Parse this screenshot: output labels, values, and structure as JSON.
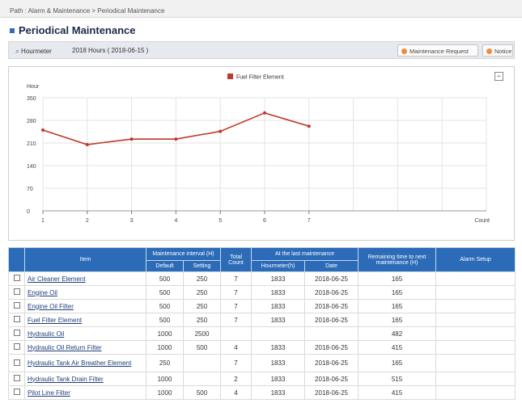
{
  "breadcrumb": "Path : Alarm & Maintenance > Periodical Maintenance",
  "page_title": "Periodical Maintenance",
  "infobar": {
    "hourmeter_label": "Hourmeter",
    "hourmeter_value": "2018 Hours ( 2018-06-15 )",
    "maintenance_request_label": "Maintenance Request",
    "notice_label": "Notice"
  },
  "chart_data": {
    "type": "line",
    "title": "",
    "ylabel": "Hour",
    "xlabel": "Count",
    "ylim": [
      0,
      350
    ],
    "yticks": [
      0,
      70,
      140,
      210,
      280,
      350
    ],
    "xticks": [
      "1",
      "2",
      "3",
      "4",
      "5",
      "6",
      "7"
    ],
    "x_slots": 11,
    "series": [
      {
        "name": "Fuel Filter Element",
        "color": "#c0392b",
        "x": [
          1,
          2,
          3,
          4,
          5,
          6,
          7
        ],
        "values": [
          250,
          205,
          222,
          222,
          246,
          303,
          262
        ]
      }
    ],
    "grid": true,
    "legend": "top-center"
  },
  "table": {
    "headers": {
      "item": "Item",
      "interval": "Maintenance interval (H)",
      "default": "Default",
      "setting": "Setting",
      "total_count": "Total Count",
      "last": "At the last maintenance",
      "hourmeter": "Hourmeter(h)",
      "date": "Date",
      "remaining": "Remaining time to next maintenance (H)",
      "alarm": "Alarm Setup"
    },
    "rows": [
      {
        "item": "Air Cleaner Element",
        "default": "500",
        "setting": "250",
        "count": "7",
        "hourmeter": "1833",
        "date": "2018-06-25",
        "remaining": "165",
        "tall": false
      },
      {
        "item": "Engine Oil",
        "default": "500",
        "setting": "250",
        "count": "7",
        "hourmeter": "1833",
        "date": "2018-06-25",
        "remaining": "165",
        "tall": false
      },
      {
        "item": "Engine Oil Filter",
        "default": "500",
        "setting": "250",
        "count": "7",
        "hourmeter": "1833",
        "date": "2018-06-25",
        "remaining": "165",
        "tall": false
      },
      {
        "item": "Fuel Filter Element",
        "default": "500",
        "setting": "250",
        "count": "7",
        "hourmeter": "1833",
        "date": "2018-06-25",
        "remaining": "165",
        "tall": false
      },
      {
        "item": "Hydraulic Oil",
        "default": "1000",
        "setting": "2500",
        "count": "",
        "hourmeter": "",
        "date": "",
        "remaining": "482",
        "tall": false
      },
      {
        "item": "Hydraulic Oil Return Filter",
        "default": "1000",
        "setting": "500",
        "count": "4",
        "hourmeter": "1833",
        "date": "2018-06-25",
        "remaining": "415",
        "tall": false
      },
      {
        "item": "Hydraulic Tank Air Breather Element",
        "default": "250",
        "setting": "",
        "count": "7",
        "hourmeter": "1833",
        "date": "2018-06-25",
        "remaining": "165",
        "tall": true
      },
      {
        "item": "Hydraulic Tank Drain Filter",
        "default": "1000",
        "setting": "",
        "count": "2",
        "hourmeter": "1833",
        "date": "2018-06-25",
        "remaining": "515",
        "tall": false
      },
      {
        "item": "Pilot Line Filter",
        "default": "1000",
        "setting": "500",
        "count": "4",
        "hourmeter": "1833",
        "date": "2018-06-25",
        "remaining": "415",
        "tall": false
      }
    ]
  }
}
